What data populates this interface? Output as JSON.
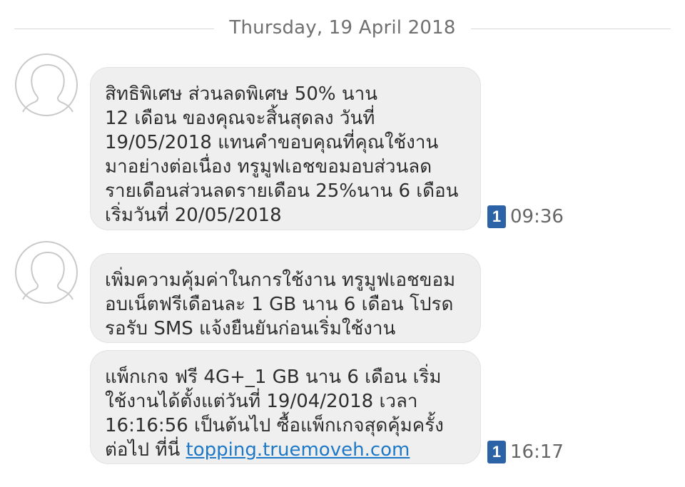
{
  "date_divider": "Thursday, 19 April 2018",
  "messages": [
    {
      "lines": [
        "สิทธิพิเศษ ส่วนลดพิเศษ 50% นาน",
        "12 เดือน ของคุณจะสิ้นสุดลง วันที่",
        "19/05/2018 แทนคำขอบคุณที่คุณใช้งาน",
        "มาอย่างต่อเนื่อง ทรูมูฟเอชขอมอบส่วนลด",
        "รายเดือนส่วนลดรายเดือน 25%นาน 6 เดือน",
        "เริ่มวันที่ 20/05/2018"
      ],
      "sim": "1",
      "time": "09:36"
    },
    {
      "lines": [
        "เพิ่มความคุ้มค่าในการใช้งาน ทรูมูฟเอชขอม",
        "อบเน็ตฟรีเดือนละ 1 GB นาน 6 เดือน โปรด",
        "รอรับ SMS แจ้งยืนยันก่อนเริ่มใช้งาน"
      ]
    },
    {
      "lines": [
        "แพ็กเกจ ฟรี 4G+_1 GB  นาน 6 เดือน เริ่ม",
        "ใช้งานได้ตั้งแต่วันที่  19/04/2018 เวลา",
        "16:16:56 เป็นต้นไป ซื้อแพ็กเกจสุดคุ้มครั้ง"
      ],
      "last_line_prefix": "ต่อไป ที่นี่ ",
      "link": "topping.truemoveh.com",
      "sim": "1",
      "time": "16:17"
    }
  ]
}
